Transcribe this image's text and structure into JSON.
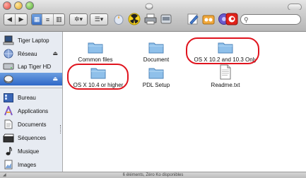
{
  "window": {
    "title": ""
  },
  "toolbar": {
    "back_label": "◀",
    "forward_label": "▶",
    "view_buttons": [
      "▦",
      "≡",
      "▥"
    ],
    "action_label": "✲▾",
    "arrange_label": "☰▾",
    "search_placeholder": "",
    "search_value": ""
  },
  "sidebar": {
    "devices": [
      {
        "label": "Tiger Laptop",
        "icon": "laptop-icon",
        "eject": false
      },
      {
        "label": "Réseau",
        "icon": "network-globe-icon",
        "eject": true
      },
      {
        "label": "Lap Tiger HD",
        "icon": "hard-drive-icon",
        "eject": false
      },
      {
        "label": "",
        "icon": "disk-image-icon",
        "eject": true,
        "selected": true
      }
    ],
    "places": [
      {
        "label": "Bureau",
        "icon": "desktop-icon"
      },
      {
        "label": "Applications",
        "icon": "applications-icon"
      },
      {
        "label": "Documents",
        "icon": "documents-icon"
      },
      {
        "label": "Séquences",
        "icon": "movies-icon"
      },
      {
        "label": "Musique",
        "icon": "music-icon"
      },
      {
        "label": "Images",
        "icon": "pictures-icon"
      }
    ]
  },
  "files": [
    {
      "label": "Common files",
      "icon": "folder-icon",
      "highlighted": false
    },
    {
      "label": "Document",
      "icon": "folder-icon",
      "highlighted": false
    },
    {
      "label": "OS X 10.2 and 10.3 Only",
      "icon": "folder-icon",
      "highlighted": true
    },
    {
      "label": "OS X 10.4 or higher",
      "icon": "folder-icon",
      "highlighted": true
    },
    {
      "label": "PDL Setup",
      "icon": "folder-icon",
      "highlighted": false
    },
    {
      "label": "Readme.txt",
      "icon": "text-document-icon",
      "highlighted": false
    }
  ],
  "status": {
    "text": "6 éléments, Zéro Ko disponibles"
  },
  "colors": {
    "highlight_circle": "#e0141e",
    "folder": "#8fc0ea",
    "selection": "#3b6fc2"
  }
}
